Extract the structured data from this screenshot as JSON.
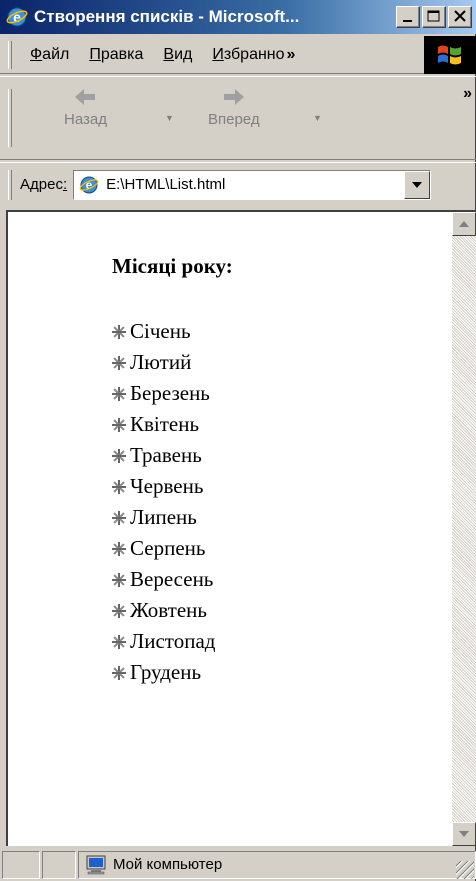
{
  "window": {
    "title": "Створення списків - Microsoft...",
    "icons": {
      "title": "ie-logo-icon",
      "minimize": "minimize-icon",
      "maximize": "maximize-icon",
      "close": "close-icon"
    }
  },
  "menu": {
    "items": [
      {
        "label": "Файл",
        "accel": "Ф",
        "rest": "айл"
      },
      {
        "label": "Правка",
        "accel": "П",
        "rest": "равка"
      },
      {
        "label": "Вид",
        "accel": "В",
        "rest": "ид"
      },
      {
        "label": "Избранно",
        "accel": "И",
        "rest": "збранно"
      }
    ],
    "overflow": "»"
  },
  "toolbar": {
    "back_label": "Назад",
    "forward_label": "Вперед",
    "overflow": "»"
  },
  "address": {
    "label_main": "Адрес",
    "label_accel": ":",
    "value": "E:\\HTML\\List.html"
  },
  "page": {
    "heading": "Місяці року:",
    "months": [
      "Січень",
      "Лютий",
      "Березень",
      "Квітень",
      "Травень",
      "Червень",
      "Липень",
      "Серпень",
      "Вересень",
      "Жовтень",
      "Листопад",
      "Грудень"
    ]
  },
  "status": {
    "zone": "Мой компьютер"
  },
  "colors": {
    "titlebar_start": "#0a246a",
    "titlebar_end": "#a6caf0",
    "chrome": "#d4d0c8"
  }
}
